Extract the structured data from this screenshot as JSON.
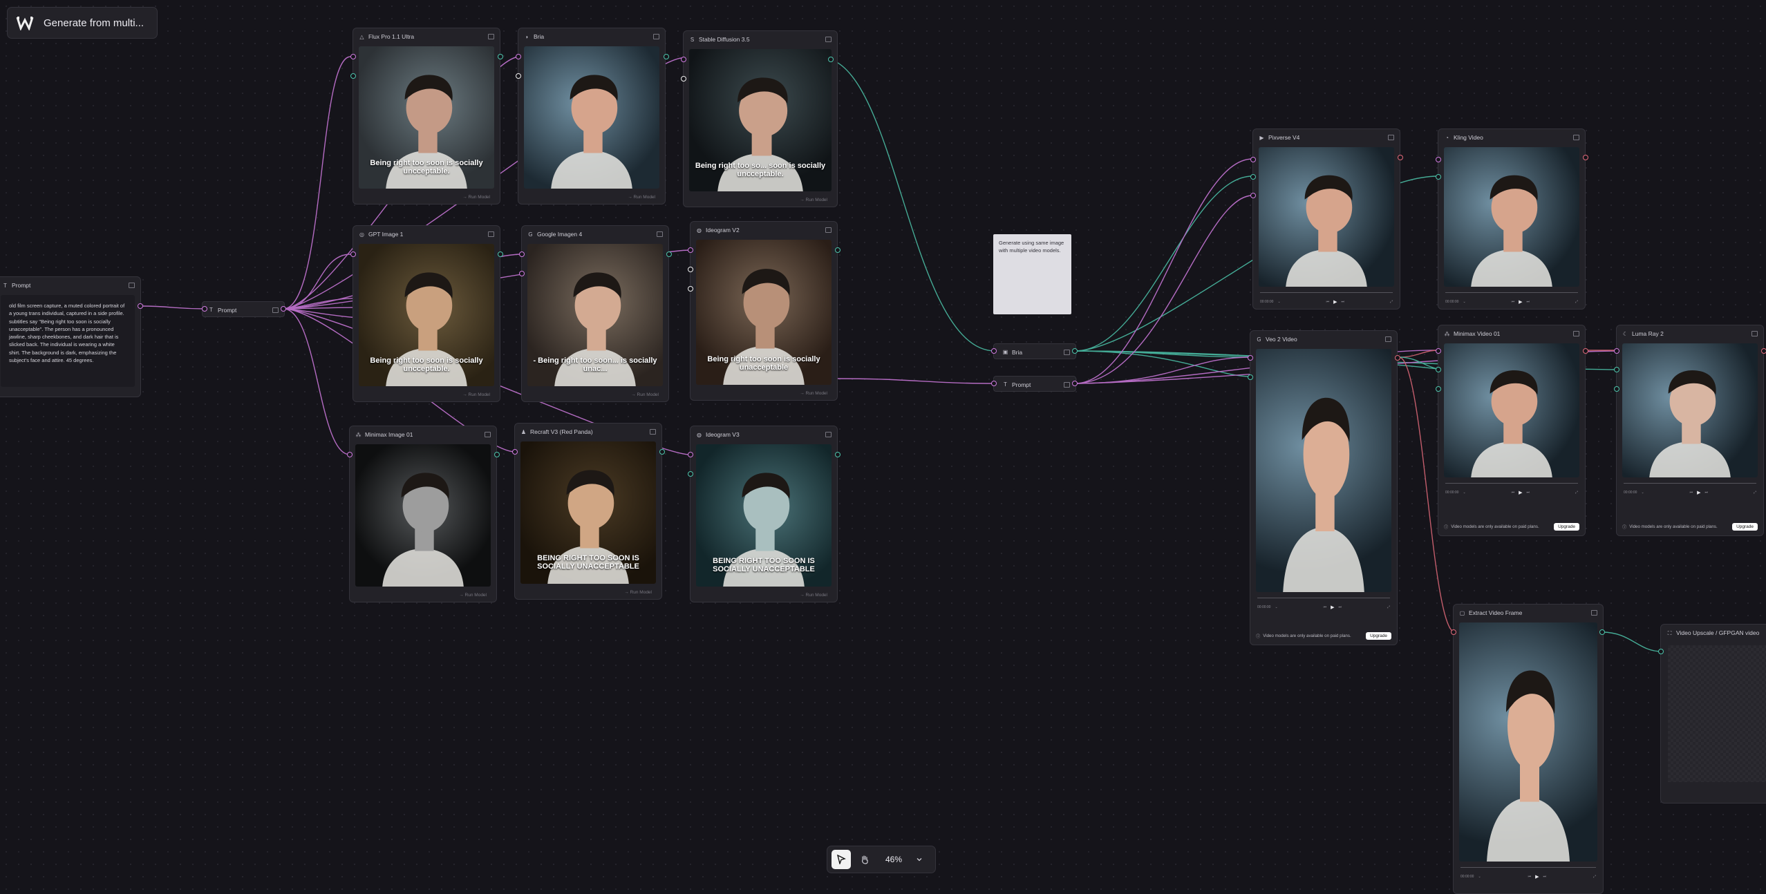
{
  "app": {
    "title": "Generate from multi..."
  },
  "prompt_node": {
    "title": "Prompt",
    "text": "old film screen capture, a muted colored portrait of a young trans individual, captured in a side profile. subtitles say \"Being right too soon is socially unacceptable\". The person has a pronounced jawline, sharp cheekbones, and dark hair that is slicked back. The individual is wearing a white shirt. The background is dark, emphasizing the subject's face and attire. 45 degrees."
  },
  "prompt_pill": {
    "label": "Prompt"
  },
  "image_nodes": [
    {
      "title": "Flux Pro 1.1 Ultra",
      "caption": "Being right too soon is socially uncceptable.",
      "run": "→ Run Model"
    },
    {
      "title": "Bria",
      "caption": "",
      "run": "→ Run Model"
    },
    {
      "title": "Stable Diffusion 3.5",
      "caption": "Being right too so... soon is socially uncceptable.",
      "run": "→ Run Model"
    },
    {
      "title": "GPT Image 1",
      "caption": "Being right too soon is socially uncceptable.",
      "run": "→ Run Model"
    },
    {
      "title": "Google Imagen 4",
      "caption": "- Being right too soon... is socially unac...",
      "run": "→ Run Model"
    },
    {
      "title": "Ideogram V2",
      "caption": "Being right too soon is socially unacceptable",
      "run": "→ Run Model"
    },
    {
      "title": "Minimax Image 01",
      "caption": "",
      "run": "→ Run Model"
    },
    {
      "title": "Recraft V3 (Red Panda)",
      "caption": "BEING RIGHT TOO SOON IS SOCIALLY UNACCEPTABLE",
      "run": "→ Run Model"
    },
    {
      "title": "Ideogram V3",
      "caption": "BEING RIGHT TOO SOON IS SOCIALLY UNACCEPTABLE",
      "run": "→ Run Model"
    }
  ],
  "note": {
    "text": "Generate using same image with multiple video models."
  },
  "bria_pill": {
    "label": "Bria"
  },
  "prompt_pill2": {
    "label": "Prompt"
  },
  "video_nodes": [
    {
      "title": "Pixverse V4",
      "time": "00:00:00",
      "paid": "",
      "upgrade": ""
    },
    {
      "title": "Kling Video",
      "time": "00:00:00",
      "paid": "",
      "upgrade": ""
    },
    {
      "title": "Veo 2 Video",
      "time": "00:00:00",
      "paid": "Video models are only available on paid plans.",
      "upgrade": "Upgrade"
    },
    {
      "title": "Minimax Video 01",
      "time": "00:00:00",
      "paid": "Video models are only available on paid plans.",
      "upgrade": "Upgrade"
    },
    {
      "title": "Luma Ray 2",
      "time": "00:00:00",
      "paid": "Video models are only available on paid plans.",
      "upgrade": "Upgrade"
    },
    {
      "title": "Extract Video Frame",
      "time": "00:00:00",
      "paid": "",
      "upgrade": ""
    }
  ],
  "upscale_node": {
    "title": "Video Upscale / GFPGAN video"
  },
  "toolbar": {
    "zoom": "46%"
  },
  "colors": {
    "canvas": "#15141a",
    "node": "#232228",
    "text_port": "#d07be0",
    "image_port": "#4dc6ac",
    "video_port": "#e26a7a"
  }
}
